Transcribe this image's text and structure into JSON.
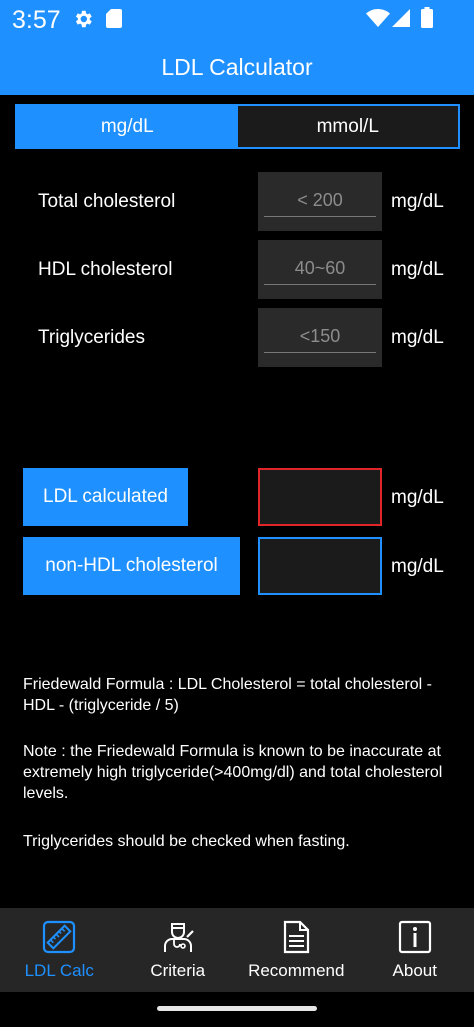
{
  "status": {
    "time": "3:57"
  },
  "app": {
    "title": "LDL Calculator"
  },
  "units": {
    "mgdl": "mg/dL",
    "mmol": "mmol/L"
  },
  "inputs": [
    {
      "label": "Total cholesterol",
      "placeholder": "< 200",
      "unit": "mg/dL"
    },
    {
      "label": "HDL cholesterol",
      "placeholder": "40~60",
      "unit": "mg/dL"
    },
    {
      "label": "Triglycerides",
      "placeholder": "<150",
      "unit": "mg/dL"
    }
  ],
  "results": [
    {
      "button": "LDL calculated",
      "unit": "mg/dL",
      "border_color": "#e0262a"
    },
    {
      "button": "non-HDL cholesterol",
      "unit": "mg/dL",
      "border_color": "#1e90ff"
    }
  ],
  "notes": {
    "formula": "Friedewald Formula : LDL Cholesterol = total cholesterol - HDL - (triglyceride / 5)",
    "accuracy": "Note : the Friedewald Formula is known to be inaccurate at extremely high triglyceride(>400mg/dl) and total cholesterol levels.",
    "fasting": "Triglycerides should be checked when fasting."
  },
  "nav": [
    {
      "label": "LDL Calc",
      "icon": "ruler-icon",
      "active": true
    },
    {
      "label": "Criteria",
      "icon": "doctor-icon",
      "active": false
    },
    {
      "label": "Recommend",
      "icon": "document-icon",
      "active": false
    },
    {
      "label": "About",
      "icon": "info-icon",
      "active": false
    }
  ],
  "colors": {
    "accent": "#1e90ff",
    "background": "#000000",
    "nav_background": "#262626"
  }
}
